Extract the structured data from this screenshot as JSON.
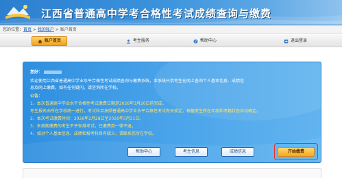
{
  "header": {
    "title": "江西省普通高中学考合格性考试成绩查询与缴费"
  },
  "breadcrumb": {
    "prefix": "您的位置：",
    "items": [
      "首页",
      "我的账户",
      "账户首页"
    ],
    "separator": " > "
  },
  "nav": {
    "items": [
      {
        "label": "账户首页",
        "icon": "home-icon"
      },
      {
        "label": "考生服务",
        "icon": "user-icon"
      },
      {
        "label": "帮助中心",
        "icon": "help-icon"
      },
      {
        "label": "退出登录",
        "icon": "logout-icon"
      }
    ]
  },
  "main": {
    "greeting": "您好：",
    "welcome_line1": "欢迎使用江西省普通高中学业水平合格性考试成绩查询与缴费系统，本系统只供考生在网上查询个人基本信息、成绩信",
    "welcome_line2": "息及网上缴费。如有任何疑问，请咨询所在学校。",
    "notice_label": "公告：",
    "notices": [
      "1、本次普通高中学业水平合格性考试缴费日期是2026年3月20日前完成。",
      "    考生报名由所在学校统一进行，考试科目按照普通高中学业水平合格性考试有关规定，根据考生所在年级和考籍状态自动确定。",
      "2、本次考试缴费时间：2026年2月28日至2026年3月31日。",
      "3、未按期缴费的考生不予安排考试，已缴费用一律不退。",
      "4、如对个人基本信息、成绩和报考科目有疑义，请联系您所在学校。"
    ],
    "buttons": {
      "help": "帮助中心",
      "student_info": "考生信息",
      "score_info": "成绩信息",
      "pay": "开始缴费"
    }
  },
  "colors": {
    "header_blue": "#2c7fcf",
    "panel_blue": "#3f9ae6",
    "accent_orange": "#f3a821",
    "highlight_red": "#e8302a",
    "notice_yellow": "#ffe36b"
  }
}
